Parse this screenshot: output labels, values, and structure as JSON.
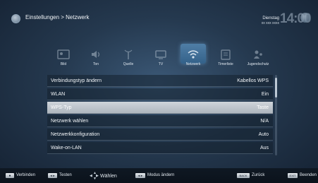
{
  "header": {
    "breadcrumb": "Einstellungen > Netzwerk",
    "date_day": "Dienstag",
    "date_sub": "xx xxx xxxx",
    "time": "14:00"
  },
  "tabs": [
    {
      "label": "Bild",
      "icon": "picture-icon",
      "active": false
    },
    {
      "label": "Ton",
      "icon": "sound-icon",
      "active": false
    },
    {
      "label": "Quelle",
      "icon": "antenna-source-icon",
      "active": false
    },
    {
      "label": "TV",
      "icon": "tv-icon",
      "active": false
    },
    {
      "label": "Netzwerk",
      "icon": "network-icon",
      "active": true
    },
    {
      "label": "Timerliste",
      "icon": "timer-list-icon",
      "active": false
    },
    {
      "label": "Jugendschutz",
      "icon": "parental-control-icon",
      "active": false
    }
  ],
  "menu": [
    {
      "label": "Verbindungstyp ändern",
      "value": "Kabellos WPS",
      "selected": false
    },
    {
      "label": "WLAN",
      "value": "Ein",
      "selected": false
    },
    {
      "label": "WPS-Typ",
      "value": "Taste",
      "selected": true
    },
    {
      "label": "Netzwerk wählen",
      "value": "N/A",
      "selected": false
    },
    {
      "label": "Netzwerkkonfiguration",
      "value": "Auto",
      "selected": false
    },
    {
      "label": "Wake-on-LAN",
      "value": "Aus",
      "selected": false
    }
  ],
  "footer": {
    "verbinden": "Verbinden",
    "testen": "Testen",
    "wahlen": "Wählen",
    "modus": "Modus ändern",
    "back_key": "BACK",
    "back_text": "Zurück",
    "exit_key": "EXIT",
    "exit_text": "Beenden"
  },
  "colors": {
    "selected_row": "#c0c7ce",
    "active_tab": "#3f6f98",
    "background": "#1b2a3b"
  }
}
